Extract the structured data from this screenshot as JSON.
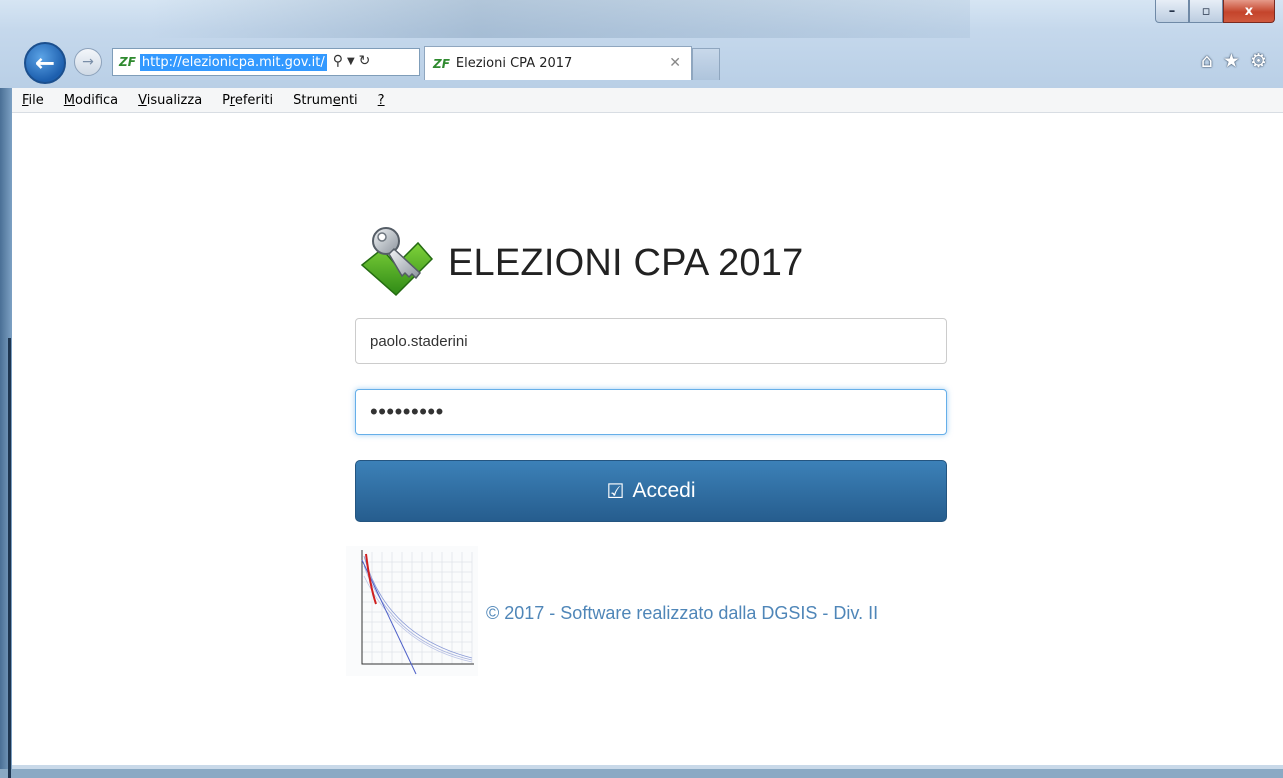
{
  "browser": {
    "url": "http://elezionicpa.mit.gov.it/",
    "tab_title": "Elezioni CPA 2017",
    "site_icon_text": "ZF",
    "menu": [
      {
        "label": "File",
        "underline": "F",
        "rest": "ile"
      },
      {
        "label": "Modifica",
        "underline": "M",
        "rest": "odifica"
      },
      {
        "label": "Visualizza",
        "underline": "V",
        "rest": "isualizza"
      },
      {
        "label": "Preferiti",
        "pre": "P",
        "underline": "r",
        "rest": "eferiti"
      },
      {
        "label": "Strumenti",
        "pre": "Strum",
        "underline": "e",
        "rest": "nti"
      },
      {
        "label": "?",
        "underline": "?",
        "rest": ""
      }
    ],
    "caption": {
      "minimize": "–",
      "maximize": "▫",
      "close": "x"
    },
    "icons": {
      "back": "arrow-left-icon",
      "forward": "arrow-right-icon",
      "home": "home-icon",
      "favorites": "star-icon",
      "settings": "gear-icon"
    }
  },
  "login": {
    "title": "ELEZIONI CPA 2017",
    "username_value": "paolo.staderini",
    "password_value": "•••••••••",
    "submit_label": "Accedi",
    "footer": "© 2017 - Software realizzato dalla DGSIS - Div. II"
  },
  "colors": {
    "primary_button": "#2d6ca2",
    "footer_text": "#4f86b8",
    "focus_border": "#66afe9"
  }
}
